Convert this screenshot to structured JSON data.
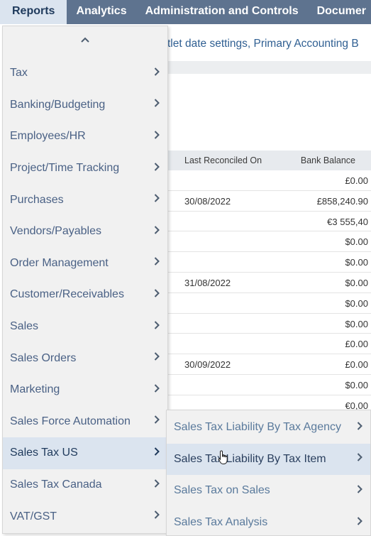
{
  "topnav": {
    "tabs": [
      "Reports",
      "Analytics",
      "Administration and Controls",
      "Documer"
    ]
  },
  "notice": "tlet date settings, Primary Accounting B",
  "table": {
    "headers": [
      "Last Reconciled On",
      "Bank Balance"
    ],
    "rows": [
      {
        "date": "",
        "balance": "£0.00"
      },
      {
        "date": "30/08/2022",
        "balance": "£858,240.90"
      },
      {
        "date": "",
        "balance": "€3 555,40"
      },
      {
        "date": "",
        "balance": "$0.00"
      },
      {
        "date": "",
        "balance": "$0.00"
      },
      {
        "date": "31/08/2022",
        "balance": "$0.00"
      },
      {
        "date": "",
        "balance": "$0.00"
      },
      {
        "date": "",
        "balance": "$0.00"
      },
      {
        "date": "",
        "balance": "£0.00"
      },
      {
        "date": "30/09/2022",
        "balance": "£0.00"
      },
      {
        "date": "",
        "balance": "$0.00"
      },
      {
        "date": "",
        "balance": "€0,00"
      }
    ]
  },
  "menu": {
    "scroll_up_icon": "chevron-up-icon",
    "items": [
      "Tax",
      "Banking/Budgeting",
      "Employees/HR",
      "Project/Time Tracking",
      "Purchases",
      "Vendors/Payables",
      "Order Management",
      "Customer/Receivables",
      "Sales",
      "Sales Orders",
      "Marketing",
      "Sales Force Automation",
      "Sales Tax US",
      "Sales Tax Canada",
      "VAT/GST"
    ],
    "active": "Sales Tax US"
  },
  "submenu": {
    "items": [
      "Sales Tax Liability By Tax Agency",
      "Sales Tax Liability By Tax Item",
      "Sales Tax on Sales",
      "Sales Tax Analysis"
    ],
    "active": "Sales Tax Liability By Tax Item"
  },
  "colors": {
    "nav_bg": "#5e738f",
    "active_bg": "#dbe4ef",
    "menu_bg": "#f1f1f1",
    "link_text": "#4a6185"
  }
}
